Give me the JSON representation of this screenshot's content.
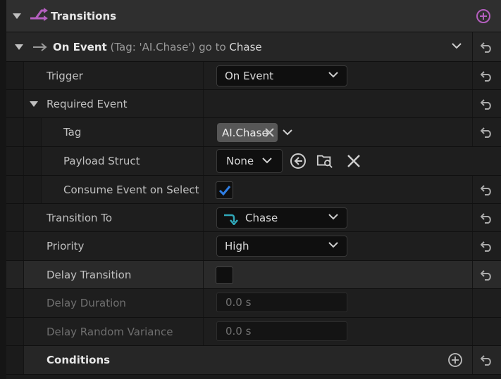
{
  "header": {
    "title": "Transitions"
  },
  "transition": {
    "label": "On Event",
    "detail_prefix": "(Tag: 'AI.Chase')",
    "goto": "go to",
    "target": "Chase"
  },
  "properties": {
    "trigger": {
      "label": "Trigger",
      "value": "On Event"
    },
    "required_event": {
      "label": "Required Event"
    },
    "tag": {
      "label": "Tag",
      "value": "AI.Chase"
    },
    "payload_struct": {
      "label": "Payload Struct",
      "value": "None"
    },
    "consume_event": {
      "label": "Consume Event on Select",
      "checked": true
    },
    "transition_to": {
      "label": "Transition To",
      "value": "Chase"
    },
    "priority": {
      "label": "Priority",
      "value": "High"
    },
    "delay_transition": {
      "label": "Delay Transition",
      "checked": false
    },
    "delay_duration": {
      "label": "Delay Duration",
      "value": "0.0 s"
    },
    "delay_random_variance": {
      "label": "Delay Random Variance",
      "value": "0.0 s"
    },
    "conditions": {
      "label": "Conditions"
    }
  },
  "colors": {
    "accent_purple": "#b45fbf",
    "check_blue": "#2f7fe5",
    "state_teal": "#30a7b8"
  }
}
